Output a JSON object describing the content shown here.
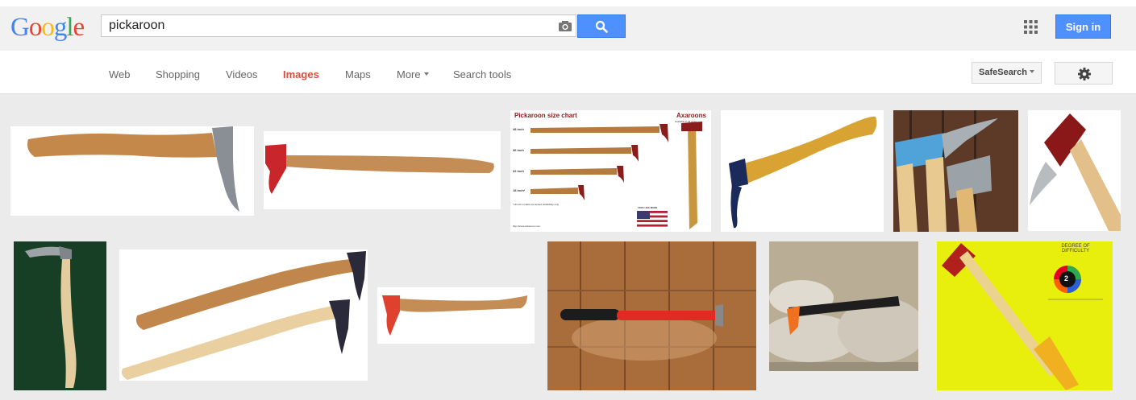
{
  "logo": {
    "text": "Google",
    "letters": [
      "G",
      "o",
      "o",
      "g",
      "l",
      "e"
    ],
    "colors": [
      "#4285f4",
      "#ea4335",
      "#fbbc05",
      "#4285f4",
      "#34a853",
      "#ea4335"
    ]
  },
  "search": {
    "query": "pickaroon"
  },
  "header": {
    "signin_label": "Sign in"
  },
  "nav": {
    "tabs": [
      {
        "label": "Web"
      },
      {
        "label": "Shopping"
      },
      {
        "label": "Videos"
      },
      {
        "label": "Images",
        "active": true
      },
      {
        "label": "Maps"
      },
      {
        "label": "More"
      }
    ],
    "search_tools_label": "Search tools",
    "safesearch_label": "SafeSearch"
  },
  "results": {
    "size_chart": {
      "title": "Pickaroon size chart",
      "brand": "Axaroons",
      "brand_sub": "Available in all sizes",
      "sizes": [
        "48 inch",
        "36 inch",
        "32 inch",
        "18 inch*"
      ],
      "footnote": "*18 inch models are limited availability only",
      "made_label": "100% USA MADE",
      "url": "http://www.pickaroon.com"
    },
    "difficulty_card": {
      "title": "DEGREE OF DIFFICULTY",
      "value": "2"
    }
  },
  "colors": {
    "accent_blue": "#4d90fe",
    "active_tab": "#dd4b39",
    "handle_wood": "#c9924e"
  }
}
